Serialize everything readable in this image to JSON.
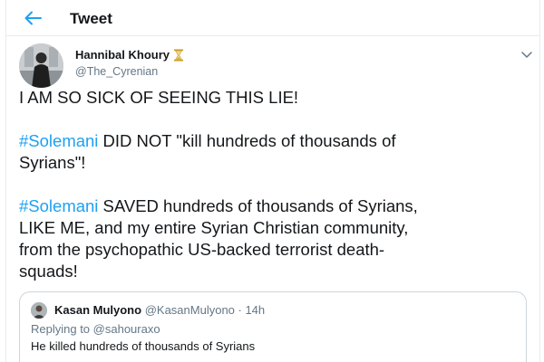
{
  "header": {
    "title": "Tweet",
    "back_icon": "arrow-left-icon",
    "accent_color": "#1da1f2"
  },
  "author": {
    "name": "Hannibal Khoury",
    "badge_icon": "hourglass-icon",
    "handle": "@The_Cyrenian"
  },
  "tweet": {
    "line1": "I AM SO SICK OF SEEING THIS LIE!",
    "p2_hashtag": "#Solemani",
    "p2_line1_rest": " DID NOT \"kill hundreds of thousands of",
    "p2_line2": "Syrians\"!",
    "p3_hashtag": "#Solemani",
    "p3_line1_rest": " SAVED hundreds of thousands of Syrians,",
    "p3_line2": "LIKE ME, and my entire Syrian Christian community,",
    "p3_line3": "from the psychopathic US-backed terrorist death-",
    "p3_line4": "squads!"
  },
  "quote": {
    "name": "Kasan Mulyono",
    "handle_time": "@KasanMulyono · 14h",
    "replying_label": "Replying to",
    "replying_to": "@sahouraxo",
    "text": "He killed hundreds of thousands of Syrians"
  }
}
